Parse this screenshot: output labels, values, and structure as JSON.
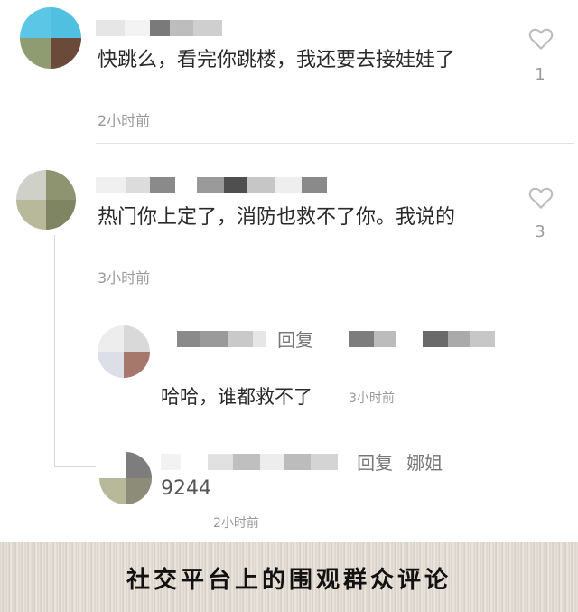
{
  "comments": [
    {
      "text": "快跳么，看完你跳楼，我还要去接娃娃了",
      "time": "2小时前",
      "likes": "1"
    },
    {
      "text": "热门你上定了，消防也救不了你。我说的",
      "time": "3小时前",
      "likes": "3",
      "replies": [
        {
          "reply_label": "回复",
          "text": "哈哈，谁都救不了",
          "time": "3小时前"
        },
        {
          "reply_label": "回复",
          "reply_to": "娜姐",
          "text": "9244",
          "time": "2小时前"
        }
      ]
    }
  ],
  "caption": "社交平台上的围观群众评论",
  "colors": {
    "muted": "#9a9a9a",
    "text": "#2a2a2a",
    "heart": "#bdbdbd"
  }
}
